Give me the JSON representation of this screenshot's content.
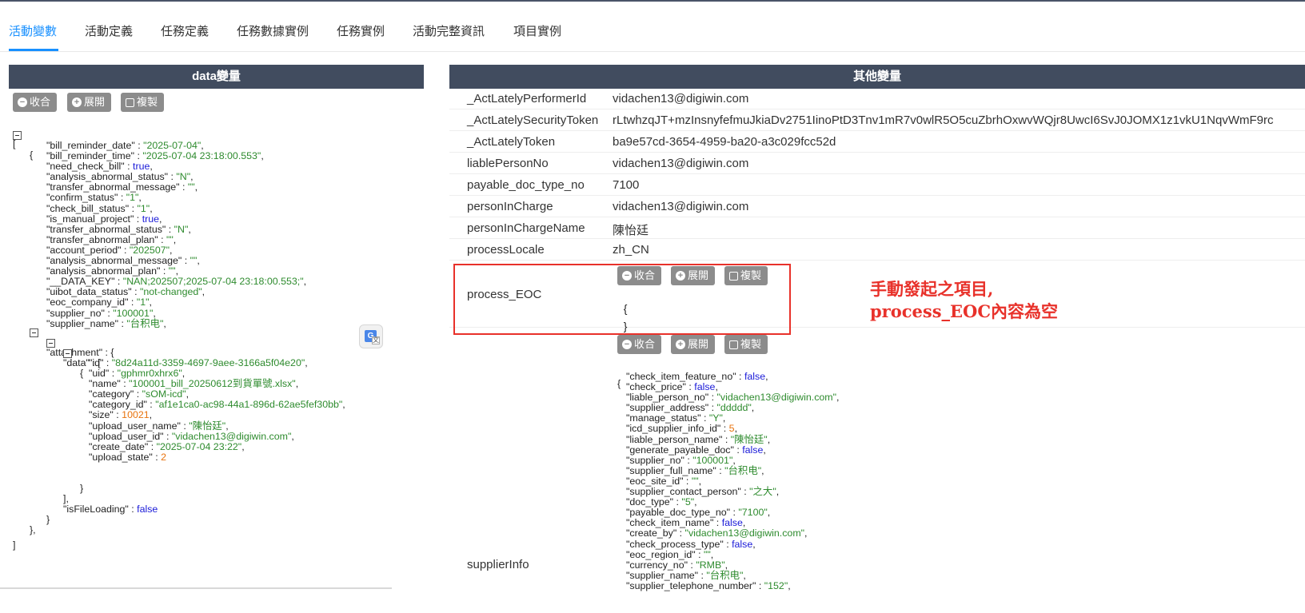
{
  "tabs": [
    {
      "label": "活動變數",
      "active": true
    },
    {
      "label": "活動定義"
    },
    {
      "label": "任務定義"
    },
    {
      "label": "任務數據實例"
    },
    {
      "label": "任務實例"
    },
    {
      "label": "活動完整資訊"
    },
    {
      "label": "項目實例"
    }
  ],
  "left_panel": {
    "title": "data變量",
    "buttons": {
      "collapse": "收合",
      "expand": "展開",
      "copy": "複製"
    },
    "json": {
      "open_bracket": "[",
      "open_brace": "{",
      "fields": [
        {
          "key": "\"bill_reminder_date\"",
          "value": "\"2025-07-04\"",
          "type": "s"
        },
        {
          "key": "\"bill_reminder_time\"",
          "value": "\"2025-07-04 23:18:00.553\"",
          "type": "s"
        },
        {
          "key": "\"need_check_bill\"",
          "value": "true",
          "type": "b"
        },
        {
          "key": "\"analysis_abnormal_status\"",
          "value": "\"N\"",
          "type": "s"
        },
        {
          "key": "\"transfer_abnormal_message\"",
          "value": "\"\"",
          "type": "s"
        },
        {
          "key": "\"confirm_status\"",
          "value": "\"1\"",
          "type": "s"
        },
        {
          "key": "\"check_bill_status\"",
          "value": "\"1\"",
          "type": "s"
        },
        {
          "key": "\"is_manual_project\"",
          "value": "true",
          "type": "b"
        },
        {
          "key": "\"transfer_abnormal_status\"",
          "value": "\"N\"",
          "type": "s"
        },
        {
          "key": "\"transfer_abnormal_plan\"",
          "value": "\"\"",
          "type": "s"
        },
        {
          "key": "\"account_period\"",
          "value": "\"202507\"",
          "type": "s"
        },
        {
          "key": "\"analysis_abnormal_message\"",
          "value": "\"\"",
          "type": "s"
        },
        {
          "key": "\"analysis_abnormal_plan\"",
          "value": "\"\"",
          "type": "s"
        },
        {
          "key": "\"__DATA_KEY\"",
          "value": "\"NAN;202507;2025-07-04 23:18:00.553;\"",
          "type": "s"
        },
        {
          "key": "\"uibot_data_status\"",
          "value": "\"not-changed\"",
          "type": "s"
        },
        {
          "key": "\"eoc_company_id\"",
          "value": "\"1\"",
          "type": "s"
        },
        {
          "key": "\"supplier_no\"",
          "value": "\"100001\"",
          "type": "s"
        },
        {
          "key": "\"supplier_name\"",
          "value": "\"台积电\"",
          "type": "s"
        }
      ],
      "attachment_key": "\"attachment\"",
      "data_key": "\"data\"",
      "attachment_fields": [
        {
          "key": "\"id\"",
          "value": "\"8d24a11d-3359-4697-9aee-3166a5f04e20\"",
          "type": "s"
        },
        {
          "key": "\"uid\"",
          "value": "\"gphmr0xhrx6\"",
          "type": "s"
        },
        {
          "key": "\"name\"",
          "value": "\"100001_bill_20250612到貨單號.xlsx\"",
          "type": "s"
        },
        {
          "key": "\"category\"",
          "value": "\"sOM-icd\"",
          "type": "s"
        },
        {
          "key": "\"category_id\"",
          "value": "\"af1e1ca0-ac98-44a1-896d-62ae5fef30bb\"",
          "type": "s"
        },
        {
          "key": "\"size\"",
          "value": "10021",
          "type": "n"
        },
        {
          "key": "\"upload_user_name\"",
          "value": "\"陳怡廷\"",
          "type": "s"
        },
        {
          "key": "\"upload_user_id\"",
          "value": "\"vidachen13@digiwin.com\"",
          "type": "s"
        },
        {
          "key": "\"create_date\"",
          "value": "\"2025-07-04 23:22\"",
          "type": "s"
        },
        {
          "key": "\"upload_state\"",
          "value": "2",
          "type": "n"
        }
      ],
      "is_file_loading_key": "\"isFileLoading\"",
      "is_file_loading_value": "false",
      "close_brace": "}",
      "close_array_comma": "],",
      "close_brace_comma": "},",
      "close_bracket": "]"
    }
  },
  "right_panel": {
    "title": "其他變量",
    "rows": [
      {
        "key": "_ActLatelyPerformerId",
        "value": "vidachen13@digiwin.com"
      },
      {
        "key": "_ActLatelySecurityToken",
        "value": "rLtwhzqJT+mzInsnyfefmuJkiaDv2751IinoPtD3Tnv1mR7v0wlR5O5cuZbrhOxwvWQjr8UwcI6SvJ0JOMX1z1vkU1NqvWmF9rc"
      },
      {
        "key": "_ActLatelyToken",
        "value": "ba9e57cd-3654-4959-ba20-a3c029fcc52d"
      },
      {
        "key": "liablePersonNo",
        "value": "vidachen13@digiwin.com"
      },
      {
        "key": "payable_doc_type_no",
        "value": "7100"
      },
      {
        "key": "personInCharge",
        "value": "vidachen13@digiwin.com"
      },
      {
        "key": "personInChargeName",
        "value": "陳怡廷"
      },
      {
        "key": "processLocale",
        "value": "zh_CN"
      }
    ],
    "process_eoc": {
      "key": "process_EOC",
      "open": "{",
      "close": "}"
    },
    "supplier_info": {
      "key": "supplierInfo",
      "open": "{",
      "fields": [
        {
          "key": "\"check_item_feature_no\"",
          "value": "false",
          "type": "b"
        },
        {
          "key": "\"check_price\"",
          "value": "false",
          "type": "b"
        },
        {
          "key": "\"liable_person_no\"",
          "value": "\"vidachen13@digiwin.com\"",
          "type": "s"
        },
        {
          "key": "\"supplier_address\"",
          "value": "\"ddddd\"",
          "type": "s"
        },
        {
          "key": "\"manage_status\"",
          "value": "\"Y\"",
          "type": "s"
        },
        {
          "key": "\"icd_supplier_info_id\"",
          "value": "5",
          "type": "n"
        },
        {
          "key": "\"liable_person_name\"",
          "value": "\"陳怡廷\"",
          "type": "s"
        },
        {
          "key": "\"generate_payable_doc\"",
          "value": "false",
          "type": "b"
        },
        {
          "key": "\"supplier_no\"",
          "value": "\"100001\"",
          "type": "s"
        },
        {
          "key": "\"supplier_full_name\"",
          "value": "\"台积电\"",
          "type": "s"
        },
        {
          "key": "\"eoc_site_id\"",
          "value": "\"\"",
          "type": "s"
        },
        {
          "key": "\"supplier_contact_person\"",
          "value": "\"之大\"",
          "type": "s"
        },
        {
          "key": "\"doc_type\"",
          "value": "\"5\"",
          "type": "s"
        },
        {
          "key": "\"payable_doc_type_no\"",
          "value": "\"7100\"",
          "type": "s"
        },
        {
          "key": "\"check_item_name\"",
          "value": "false",
          "type": "b"
        },
        {
          "key": "\"create_by\"",
          "value": "\"vidachen13@digiwin.com\"",
          "type": "s"
        },
        {
          "key": "\"check_process_type\"",
          "value": "false",
          "type": "b"
        },
        {
          "key": "\"eoc_region_id\"",
          "value": "\"\"",
          "type": "s"
        },
        {
          "key": "\"currency_no\"",
          "value": "\"RMB\"",
          "type": "s"
        },
        {
          "key": "\"supplier_name\"",
          "value": "\"台积电\"",
          "type": "s"
        },
        {
          "key": "\"supplier_telephone_number\"",
          "value": "\"152\"",
          "type": "s"
        }
      ]
    }
  },
  "annotation": {
    "line1": "手動發起之項目,",
    "line2": "process_EOC內容為空",
    "color": "#e8312a"
  },
  "colors": {
    "accent": "#1890ff",
    "header_bg": "#414c5f",
    "button_bg": "#8c8c8c",
    "string": "#2e8b2e",
    "boolean": "#1a1ad8",
    "number": "#e8720c"
  }
}
